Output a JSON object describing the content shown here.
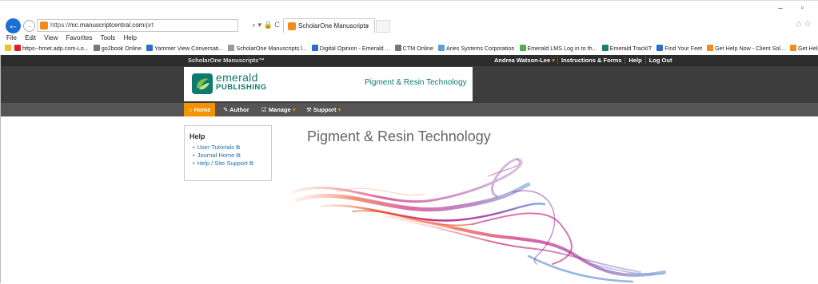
{
  "browser": {
    "address_prefix": "https://",
    "address_domain": "mc.manuscriptcentral.com",
    "address_suffix": "/prt",
    "address_icons": "⌕ ▾ 🔒 C",
    "tab_title": "ScholarOne Manuscripts",
    "tab_close": "×",
    "window_controls": "–  ▫",
    "home_fav_icons": "⌂ ☆",
    "menu": [
      "File",
      "Edit",
      "View",
      "Favorites",
      "Tools",
      "Help"
    ],
    "favorites": [
      {
        "label": "https--hrnet.adp.com-Lo...",
        "color": "#d9202a"
      },
      {
        "label": "go2book Online",
        "color": "#777777"
      },
      {
        "label": "Yammer View Conversati...",
        "color": "#2a6ec8"
      },
      {
        "label": "ScholarOne Manuscripts l...",
        "color": "#999999"
      },
      {
        "label": "Digital Opinion - Emerald ...",
        "color": "#2a6ec8"
      },
      {
        "label": "CTM Online",
        "color": "#777777"
      },
      {
        "label": "Aries Systems Corporation",
        "color": "#5aa0d8"
      },
      {
        "label": "Emerald LMS Log in to th...",
        "color": "#4caf50"
      },
      {
        "label": "Emerald TrackIT",
        "color": "#1a7f6f"
      },
      {
        "label": "Find Your Feet",
        "color": "#2a6ec8"
      },
      {
        "label": "Get Help Now - Client Sol...",
        "color": "#f08c1a"
      },
      {
        "label": "Get Help Now - ScholarO...",
        "color": "#f08c1a"
      }
    ]
  },
  "topbar": {
    "brand": "ScholarOne Manuscripts™",
    "user": "Andrea Watson-Lee",
    "links": [
      "Instructions & Forms",
      "Help",
      "Log Out"
    ]
  },
  "header": {
    "logo_line1": "emerald",
    "logo_line2": "PUBLISHING",
    "journal": "Pigment & Resin Technology"
  },
  "nav": {
    "home": "Home",
    "author": "Author",
    "manage": "Manage",
    "support": "Support"
  },
  "help": {
    "title": "Help",
    "links": [
      "User Tutorials",
      "Journal Home",
      "Help / Site Support"
    ]
  },
  "main": {
    "heading": "Pigment & Resin Technology"
  },
  "colors": {
    "accent": "#f49200",
    "brand_teal": "#0c7a6f",
    "link": "#1a6fb3"
  }
}
